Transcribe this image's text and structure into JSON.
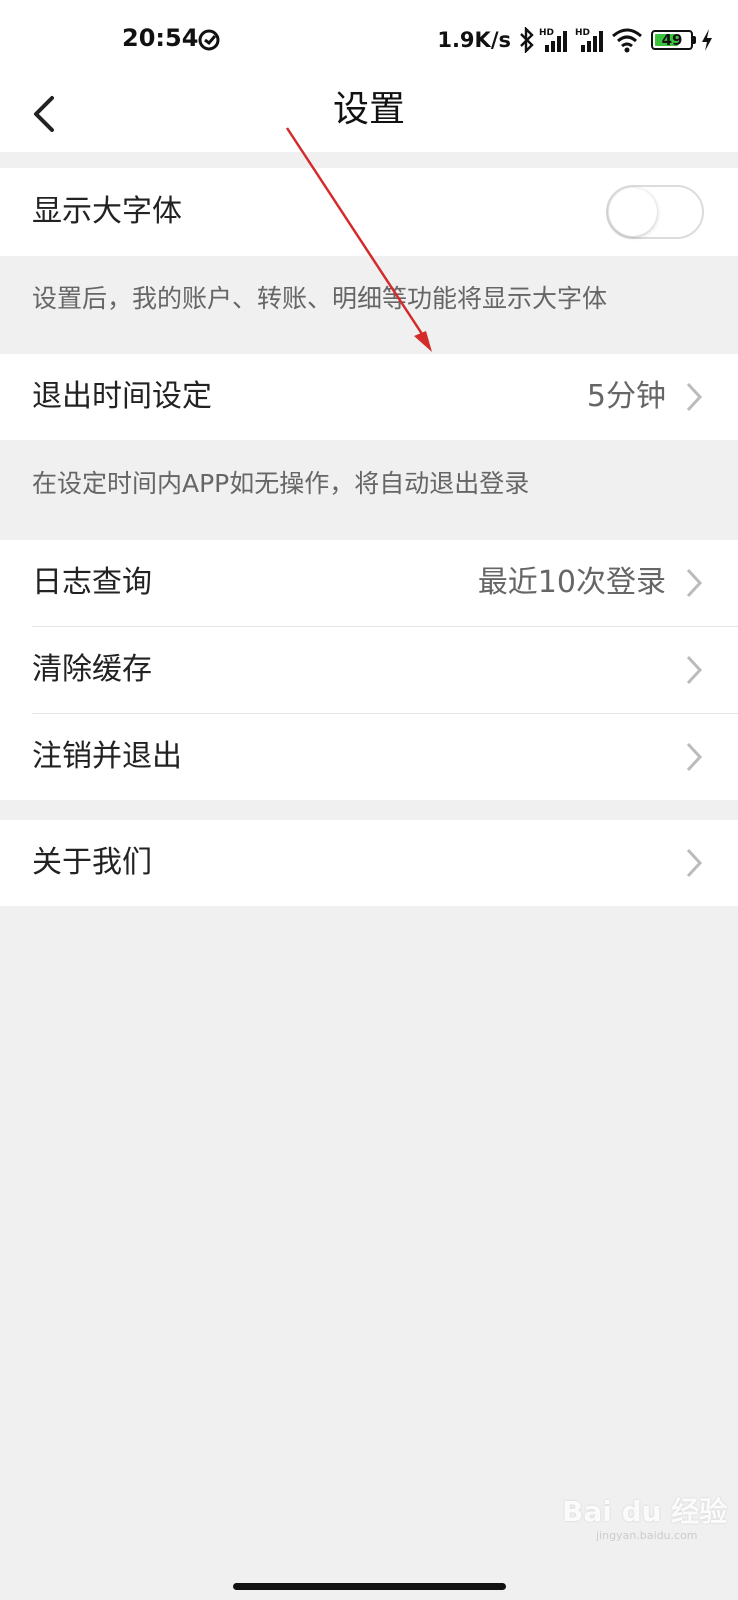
{
  "status_bar": {
    "time": "20:54",
    "network_speed": "1.9K/s",
    "battery_level": "49",
    "icons": [
      "alarm-icon",
      "bluetooth-icon",
      "hd-signal-icon",
      "hd-signal-icon",
      "wifi-icon",
      "battery-icon",
      "charging-icon"
    ]
  },
  "header": {
    "title": "设置",
    "back_icon": "chevron-left-icon"
  },
  "settings": {
    "large_font": {
      "label": "显示大字体",
      "enabled": false,
      "hint": "设置后，我的账户、转账、明细等功能将显示大字体"
    },
    "logout_time": {
      "label": "退出时间设定",
      "value": "5分钟",
      "hint": "在设定时间内APP如无操作，将自动退出登录"
    },
    "log_query": {
      "label": "日志查询",
      "value": "最近10次登录"
    },
    "clear_cache": {
      "label": "清除缓存"
    },
    "logout": {
      "label": "注销并退出"
    },
    "about": {
      "label": "关于我们"
    }
  },
  "watermark": {
    "text": "Bai du 经验",
    "sub": "jingyan.baidu.com"
  },
  "colors": {
    "background": "#f0f0f0",
    "annotation_arrow": "#d42a2a",
    "battery": "#3cc13c"
  }
}
